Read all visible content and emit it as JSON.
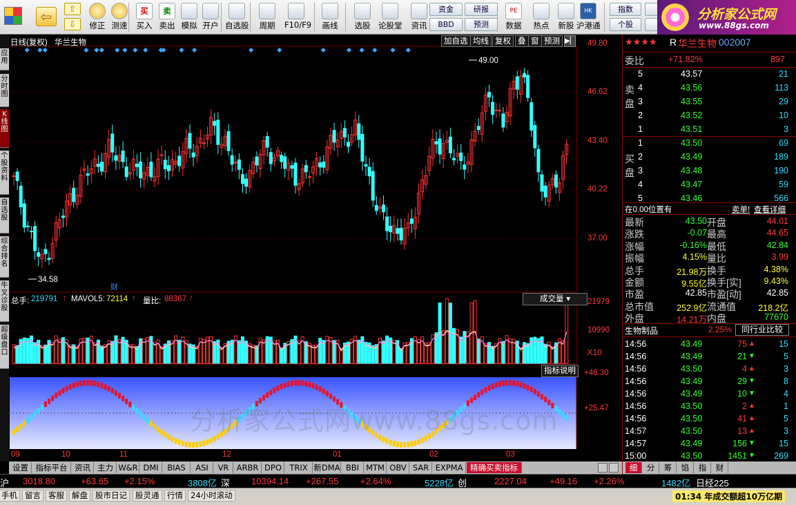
{
  "toolbar": {
    "buttons": [
      {
        "label": "修正",
        "icon": "arrow-up-down-icon"
      },
      {
        "label": "测速",
        "icon": "clock-icon"
      },
      {
        "label": "买入",
        "icon": "buy-icon"
      },
      {
        "label": "卖出",
        "icon": "sell-icon"
      },
      {
        "label": "模拟",
        "icon": "hammer-icon"
      },
      {
        "label": "开户",
        "icon": "lock-icon"
      },
      {
        "label": "自选股",
        "icon": "star-list-icon"
      },
      {
        "label": "周期",
        "icon": "period-icon"
      },
      {
        "label": "F10/F9",
        "icon": "f10-icon"
      },
      {
        "label": "画线",
        "icon": "pen-icon"
      },
      {
        "label": "选股",
        "icon": "monitor-icon"
      },
      {
        "label": "论股堂",
        "icon": "discuss-icon"
      },
      {
        "label": "资讯",
        "icon": "news-icon"
      },
      {
        "label": "数据",
        "icon": "pe-icon"
      },
      {
        "label": "热点",
        "icon": "hot-icon"
      },
      {
        "label": "新股",
        "icon": "new-stock-icon"
      },
      {
        "label": "沪港通",
        "icon": "hk-connect-icon"
      }
    ],
    "small_buttons": [
      "资金",
      "研报",
      "BBD",
      "预测",
      "指数",
      "全",
      "个股",
      "相"
    ],
    "back_icon": "back-arrow-icon",
    "icons_glyphs": [
      "買",
      "卖"
    ],
    "brand_title": "分析家公式网",
    "brand_url": "www.88gs.com",
    "brand_icon": "logo-flower-icon"
  },
  "left_tabs": [
    "应用",
    "分时图",
    "K线图",
    "个股资料",
    "自选股",
    "综合排名",
    "牛叉诊股",
    "超级盘口"
  ],
  "chart": {
    "period_label": "日线(复权)",
    "stock_name": "华兰生物",
    "top_buttons": [
      "加自选",
      "均线",
      "复权",
      "叠",
      "窗",
      "预测"
    ],
    "price_ticks": [
      "49.80",
      "46.62",
      "43.40",
      "40.22",
      "37.00"
    ],
    "max_label": "49.00",
    "min_label": "34.58",
    "finance_marker": "财",
    "vol_info": {
      "label": "总手:",
      "value": "219791",
      "mavol_label": "MAVOL5:",
      "mavol": "72114",
      "ratio_label": "量比:",
      "ratio": "88367"
    },
    "vol_dropdown": "成交量",
    "vol_ticks": [
      "21979",
      "10990",
      "X10"
    ],
    "indicator_button": "指标说明",
    "ind_ticks": [
      "+46.30",
      "+25.47"
    ],
    "x_labels": [
      "09",
      "10",
      "11",
      "12",
      "01",
      "02",
      "03"
    ],
    "watermark": "分析家公式网www.88gs.com",
    "colors": {
      "up": "#ff3333",
      "down": "#33ffff",
      "grid": "#7a0000",
      "ma": "#ffff66",
      "ind_bg_top": "#3a55ff",
      "ind_bg_bot": "#e6e9ff"
    }
  },
  "bottom_tabs": [
    "设置",
    "指标平台",
    "资讯",
    "主力",
    "W&R",
    "DMI",
    "BIAS",
    "ASI",
    "VR",
    "ARBR",
    "DPO",
    "TRIX",
    "新DMA",
    "BBI",
    "MTM",
    "OBV",
    "SAR",
    "EXPMA",
    "精确买卖指标"
  ],
  "right": {
    "stars": "★★★★",
    "code_prefix": "R",
    "name": "华兰生物",
    "code": "002007",
    "weibi_label": "委比",
    "weibi_value": "+71.82%",
    "weicha": "897",
    "sell_label": "卖盘",
    "buy_label": "买盘",
    "asks": [
      {
        "lv": "5",
        "p": "43.57",
        "v": "21"
      },
      {
        "lv": "4",
        "p": "43.56",
        "v": "113"
      },
      {
        "lv": "3",
        "p": "43.55",
        "v": "29"
      },
      {
        "lv": "2",
        "p": "43.52",
        "v": "10"
      },
      {
        "lv": "1",
        "p": "43.51",
        "v": "3"
      }
    ],
    "bids": [
      {
        "lv": "1",
        "p": "43.50",
        "v": "69"
      },
      {
        "lv": "2",
        "p": "43.49",
        "v": "189"
      },
      {
        "lv": "3",
        "p": "43.48",
        "v": "190"
      },
      {
        "lv": "4",
        "p": "43.47",
        "v": "59"
      },
      {
        "lv": "5",
        "p": "43.46",
        "v": "566"
      }
    ],
    "pos_label": "在0.00位置有",
    "sell_order_link": "卖单!",
    "detail_link": "查看详细",
    "quote": [
      {
        "l1": "最新",
        "v1": "43.50",
        "l2": "开盘",
        "v2": "44.01",
        "c1": "grn",
        "c2": "red"
      },
      {
        "l1": "涨跌",
        "v1": "-0.07",
        "l2": "最高",
        "v2": "44.65",
        "c1": "grn",
        "c2": "red"
      },
      {
        "l1": "涨幅",
        "v1": "-0.16%",
        "l2": "最低",
        "v2": "42.84",
        "c1": "grn",
        "c2": "grn"
      },
      {
        "l1": "振幅",
        "v1": "4.15%",
        "l2": "量比",
        "v2": "3.99",
        "c1": "yel",
        "c2": "red"
      },
      {
        "l1": "总手",
        "v1": "21.98万",
        "l2": "换手",
        "v2": "4.38%",
        "c1": "yel",
        "c2": "yel"
      },
      {
        "l1": "金额",
        "v1": "9.55亿",
        "l2": "换手[实]",
        "v2": "9.43%",
        "c1": "yel",
        "c2": "yel"
      },
      {
        "l1": "市盈",
        "v1": "42.85",
        "l2": "市盈[动]",
        "v2": "42.85",
        "c1": "wht",
        "c2": "wht"
      },
      {
        "l1": "总市值",
        "v1": "252.9亿",
        "l2": "流通值",
        "v2": "218.2亿",
        "c1": "yel",
        "c2": "yel"
      },
      {
        "l1": "外盘",
        "v1": "14.21万",
        "l2": "内盘",
        "v2": "77670",
        "c1": "red",
        "c2": "grn"
      }
    ],
    "industry": "生物制品",
    "industry_pct": "2.25%",
    "industry_btn": "同行业比较",
    "ticks": [
      {
        "t": "14:56",
        "p": "43.49",
        "v": "75",
        "d": "up",
        "n": "15"
      },
      {
        "t": "14:56",
        "p": "43.49",
        "v": "21",
        "d": "down",
        "n": "5"
      },
      {
        "t": "14:56",
        "p": "43.50",
        "v": "4",
        "d": "up",
        "n": "3"
      },
      {
        "t": "14:56",
        "p": "43.49",
        "v": "29",
        "d": "down",
        "n": "8"
      },
      {
        "t": "14:56",
        "p": "43.49",
        "v": "10",
        "d": "down",
        "n": "4"
      },
      {
        "t": "14:56",
        "p": "43.50",
        "v": "2",
        "d": "up",
        "n": "1"
      },
      {
        "t": "14:56",
        "p": "43.50",
        "v": "41",
        "d": "up",
        "n": "5"
      },
      {
        "t": "14:57",
        "p": "43.50",
        "v": "13",
        "d": "up",
        "n": "3"
      },
      {
        "t": "14:57",
        "p": "43.49",
        "v": "156",
        "d": "down",
        "n": "15"
      },
      {
        "t": "15:00",
        "p": "43.50",
        "v": "1451",
        "d": "down",
        "n": "269"
      }
    ],
    "bottom_tabs": [
      "细",
      "分",
      "筹",
      "馅",
      "指",
      "财"
    ]
  },
  "index_bar": {
    "sh_label": "沪",
    "sh_val": "3018.80",
    "sh_chg": "+63.65",
    "sh_pct": "+2.15%",
    "sh_amt": "3808亿",
    "sz_label": "深",
    "sz_val": "10394.14",
    "sz_chg": "+267.55",
    "sz_pct": "+2.64%",
    "sz_amt": "5228亿",
    "cy_label": "创",
    "cy_val": "2227.04",
    "cy_chg": "+49.16",
    "cy_pct": "+2.26%",
    "cy_amt": "1482亿",
    "rz_label": "日经225"
  },
  "status": {
    "items": [
      "手机",
      "留言",
      "客服",
      "解盘",
      "股市日记",
      "股灵通",
      "行情",
      "24小时滚动"
    ],
    "ticker": "01:34 年成交额超10万亿期"
  }
}
